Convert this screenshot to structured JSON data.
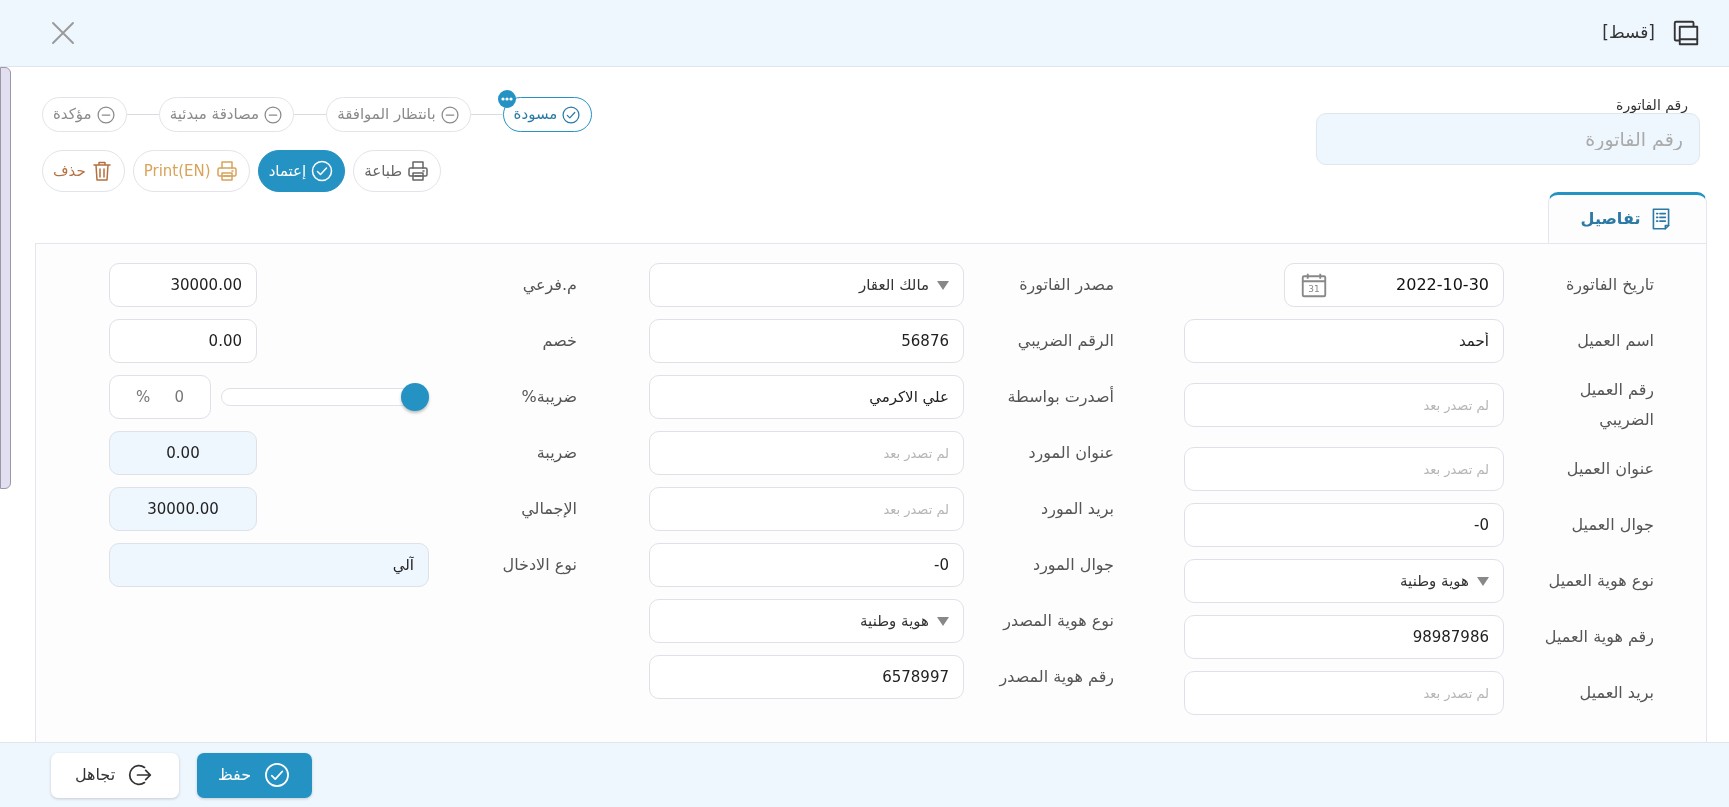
{
  "window": {
    "title": "[قسط]"
  },
  "invoice_number": {
    "label": "رقم الفاتورة",
    "placeholder": "رقم الفاتورة"
  },
  "status_steps": [
    {
      "label": "مسودة",
      "selected": true
    },
    {
      "label": "بانتظار الموافقة",
      "selected": false
    },
    {
      "label": "مصادقة مبدئية",
      "selected": false
    },
    {
      "label": "مؤكدة",
      "selected": false
    }
  ],
  "actions": [
    {
      "label": "طباعة",
      "kind": "print"
    },
    {
      "label": "إعتماد",
      "kind": "approve"
    },
    {
      "label": "Print(EN)",
      "kind": "print_en"
    },
    {
      "label": "حذف",
      "kind": "delete"
    }
  ],
  "tabs": [
    {
      "label": "تفاصيل",
      "selected": true
    }
  ],
  "form": {
    "columns": [
      [
        {
          "label": "تاريخ الفاتورة",
          "kind": "date",
          "value": "2022-10-30",
          "calendar_day": "31"
        },
        {
          "label": "اسم العميل",
          "kind": "text",
          "value": "أحمد"
        },
        {
          "label": "رقم العميل الضريبي",
          "kind": "text",
          "placeholder": "لم تصدر بعد"
        },
        {
          "label": "عنوان العميل",
          "kind": "text",
          "placeholder": "لم تصدر بعد"
        },
        {
          "label": "جوال العميل",
          "kind": "text",
          "value": "-0"
        },
        {
          "label": "نوع هوية العميل",
          "kind": "select",
          "value": "هوية وطنية"
        },
        {
          "label": "رقم هوية العميل",
          "kind": "text",
          "value": "98987986"
        },
        {
          "label": "بريد العميل",
          "kind": "text",
          "placeholder": "لم تصدر بعد"
        }
      ],
      [
        {
          "label": "مصدر الفاتورة",
          "kind": "select",
          "value": "مالك العقار"
        },
        {
          "label": "الرقم الضريبي",
          "kind": "text",
          "value": "56876"
        },
        {
          "label": "أصدرت بواسطة",
          "kind": "text",
          "value": "علي الاكرمي"
        },
        {
          "label": "عنوان المورد",
          "kind": "text",
          "placeholder": "لم تصدر بعد"
        },
        {
          "label": "بريد المورد",
          "kind": "text",
          "placeholder": "لم تصدر بعد"
        },
        {
          "label": "جوال المورد",
          "kind": "text",
          "value": "-0"
        },
        {
          "label": "نوع هوية المصدر",
          "kind": "select",
          "value": "هوية وطنية"
        },
        {
          "label": "رقم هوية المصدر",
          "kind": "text",
          "value": "6578997"
        }
      ],
      [
        {
          "label": "م.فرعي",
          "kind": "amount",
          "value": "30000.00"
        },
        {
          "label": "خصم",
          "kind": "amount",
          "value": "0.00"
        },
        {
          "label": "ضريبة%",
          "kind": "slider",
          "level": 0,
          "value": "0",
          "unit": "%"
        },
        {
          "label": "ضريبة",
          "kind": "amount_readonly",
          "value": "0.00"
        },
        {
          "label": "الإجمالي",
          "kind": "amount_readonly",
          "value": "30000.00"
        },
        {
          "label": "نوع الادخال",
          "kind": "readonly",
          "value": "آلي"
        }
      ]
    ]
  },
  "footer_buttons": [
    {
      "label": "حفظ",
      "kind": "primary"
    },
    {
      "label": "تجاهل",
      "kind": "secondary"
    }
  ]
}
